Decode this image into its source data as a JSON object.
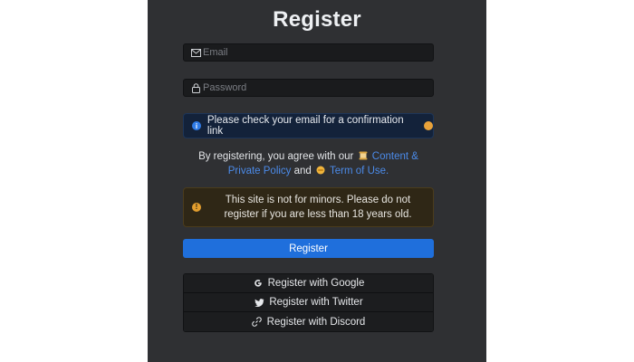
{
  "header": {
    "title": "Register"
  },
  "form": {
    "email_placeholder": "Email",
    "email_value": "",
    "password_placeholder": "Password",
    "password_value": ""
  },
  "info_alert": {
    "text": "Please check your email for a confirmation link",
    "icon": "info-icon",
    "color": "#2f7be6"
  },
  "agreement": {
    "prefix": "By registering, you agree with our",
    "content_link": "Content & Private Policy",
    "conjunction": "and",
    "terms_link": "Term of Use."
  },
  "warning_alert": {
    "text": "This site is not for minors. Please do not register if you are less than 18 years old.",
    "icon": "warning-icon",
    "color": "#e39e2e"
  },
  "primary_button": {
    "label": "Register",
    "color": "#1f6fdc"
  },
  "social": [
    {
      "label": "Register with Google",
      "icon": "google-icon"
    },
    {
      "label": "Register with Twitter",
      "icon": "twitter-icon"
    },
    {
      "label": "Register with Discord",
      "icon": "link-icon"
    }
  ]
}
